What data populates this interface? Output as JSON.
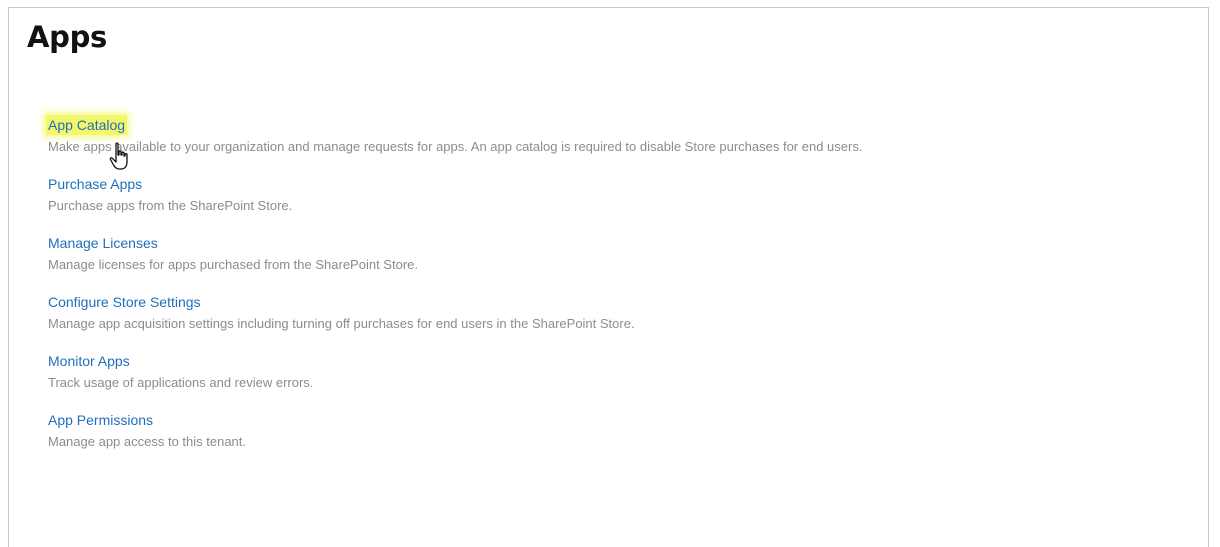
{
  "page": {
    "title": "Apps"
  },
  "apps": [
    {
      "label": "App Catalog",
      "description": "Make apps available to your organization and manage requests for apps. An app catalog is required to disable Store purchases for end users.",
      "highlighted": true
    },
    {
      "label": "Purchase Apps",
      "description": "Purchase apps from the SharePoint Store.",
      "highlighted": false
    },
    {
      "label": "Manage Licenses",
      "description": "Manage licenses for apps purchased from the SharePoint Store.",
      "highlighted": false
    },
    {
      "label": "Configure Store Settings",
      "description": "Manage app acquisition settings including turning off purchases for end users in the SharePoint Store.",
      "highlighted": false
    },
    {
      "label": "Monitor Apps",
      "description": "Track usage of applications and review errors.",
      "highlighted": false
    },
    {
      "label": "App Permissions",
      "description": "Manage app access to this tenant.",
      "highlighted": false
    }
  ],
  "cursor": {
    "icon": "hand-pointer-icon"
  },
  "colors": {
    "link": "#1f6fbd",
    "description": "#8c8c8c",
    "highlight": "#f4f76a"
  }
}
